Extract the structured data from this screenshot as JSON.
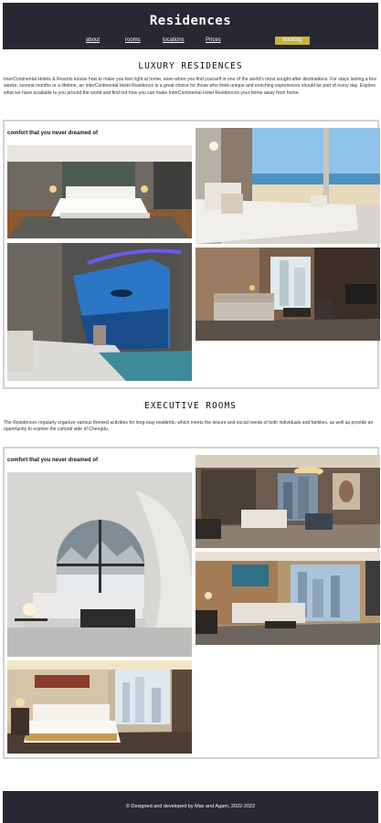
{
  "header": {
    "title": "Residences",
    "nav": [
      {
        "label": "about"
      },
      {
        "label": "rooms"
      },
      {
        "label": "locations"
      },
      {
        "label": "Prices"
      }
    ],
    "booking_label": "booking",
    "accent_color": "#c7b23f",
    "bar_color": "#272831"
  },
  "luxury": {
    "title": "LUXURY RESIDENCES",
    "text": "InterContinental Hotels & Resorts knows how to make you feel right at home, even when you find yourself in one of the world’s most sought-after destinations. For stays lasting a few weeks, several months or a lifetime, an InterContinental Hotel Residence is a great choice for those who think unique and enriching experiences should be part of every day. Explore what we have available to you around the world and find out how you can make InterContinental Hotel Residences your home away from home.",
    "caption": "comfort that you never dreamed of"
  },
  "executive": {
    "title": "EXECUTIVE ROOMS",
    "text": "The Residences regularly organize various themed activities for long-stay residents, which meets the leisure and social needs of both individuals and families, as well as provide an opportunity to explore the cultural side of Chengdu.",
    "caption": "comfort that you never dreamed of"
  },
  "footer": {
    "text": "© Designed and developed by Max and Agam, 2022-2022"
  }
}
